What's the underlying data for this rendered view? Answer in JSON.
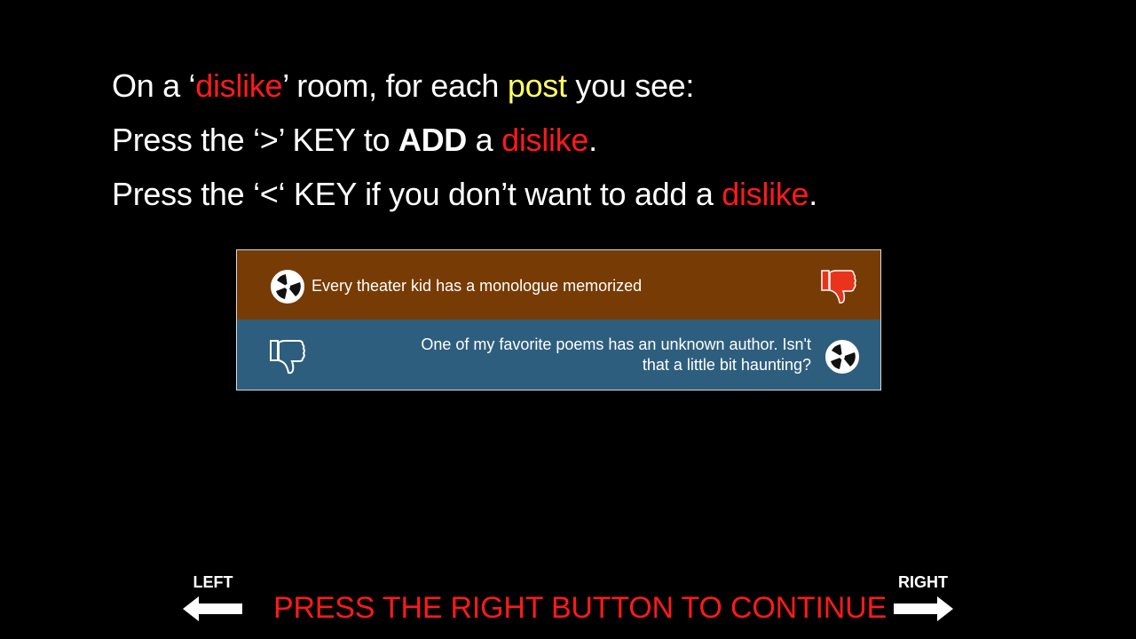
{
  "instructions": {
    "line1": {
      "a": "On a ‘",
      "b": "dislike",
      "c": "’ room, for each ",
      "d": "post",
      "e": " you see:"
    },
    "line2": {
      "a": "Press the ‘>’ KEY to ",
      "b": "ADD",
      "c": " a ",
      "d": "dislike",
      "e": "."
    },
    "line3": {
      "a": "Press the ‘<‘ KEY if you don’t want to add a ",
      "b": "dislike",
      "c": "."
    }
  },
  "posts": [
    {
      "text": "Every theater kid has a monologue memorized",
      "background": "#773c06",
      "dislike_active": true
    },
    {
      "text": "One of my favorite poems has an unknown author. Isn't that a little bit haunting?",
      "background": "#2e5e7e",
      "dislike_active": false
    }
  ],
  "navigation": {
    "left_label": "LEFT",
    "right_label": "RIGHT",
    "continue_text": "PRESS THE RIGHT BUTTON TO CONTINUE"
  },
  "colors": {
    "background": "#000000",
    "highlight_red": "#ff1a1a",
    "highlight_yellow": "#ffff66",
    "thumb_active": "#e8341c"
  }
}
